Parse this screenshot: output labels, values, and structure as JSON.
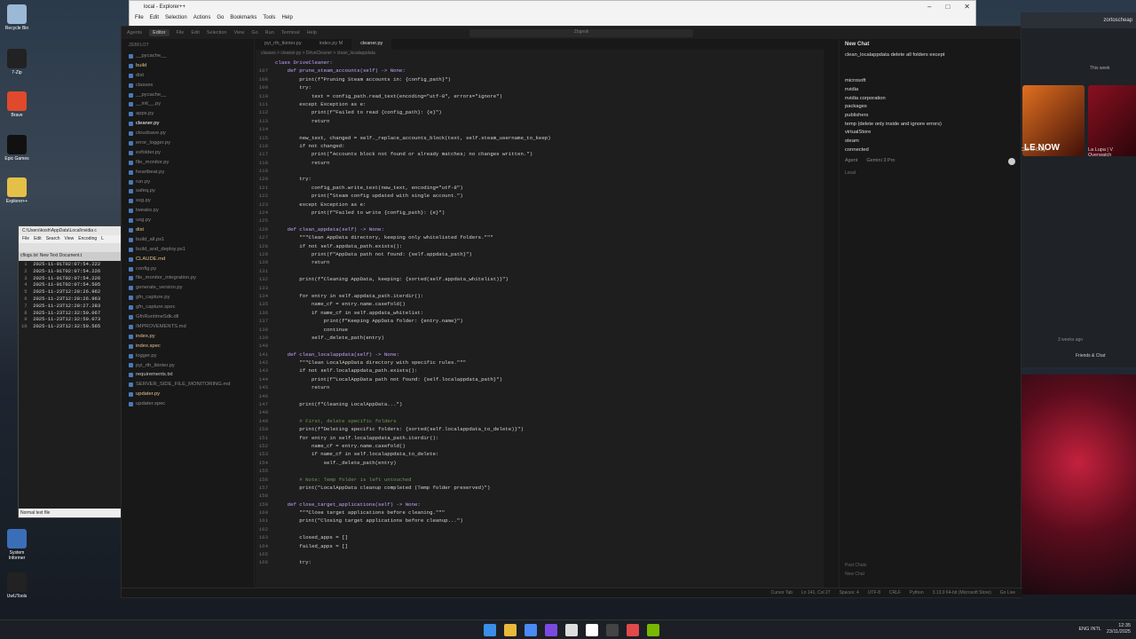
{
  "desktop": {
    "icons": [
      {
        "label": "Recycle Bin",
        "color": "#9bb8d6"
      },
      {
        "label": "7-Zip",
        "color": "#222"
      },
      {
        "label": "Brave",
        "color": "#e0492b"
      },
      {
        "label": "Epic Games",
        "color": "#111"
      },
      {
        "label": "Explorer++",
        "color": "#e5c048"
      },
      {
        "label": "System Informer",
        "color": "#3a6fb8"
      },
      {
        "label": "UwUTools",
        "color": "#222"
      }
    ]
  },
  "explorer": {
    "title": "local - Explorer++",
    "menu": [
      "File",
      "Edit",
      "Selection",
      "Actions",
      "Go",
      "Bookmarks",
      "Tools",
      "Help"
    ]
  },
  "notepad": {
    "title": "C:\\Users\\kosh\\AppData\\Local\\nvidia c",
    "menu": [
      "File",
      "Edit",
      "Search",
      "View",
      "Encoding",
      "L"
    ],
    "tabs": [
      "cflogs.txt",
      "New Text Document.t"
    ],
    "lines": [
      "2025-11-01T02:07:54.222",
      "2025-11-01T02:07:54.226",
      "2025-11-01T02:07:54.226",
      "2025-11-01T02:07:54.505",
      "2025-11-23T12:28:26.962",
      "2025-11-23T12:28:26.963",
      "2025-11-23T12:28:27.283",
      "2025-11-23T12:32:50.067",
      "2025-11-23T12:32:50.073",
      "2025-11-23T12:32:50.565"
    ],
    "status": "Normal text file"
  },
  "cursor": {
    "topbar": {
      "agents": "Agents",
      "editor": "Editor",
      "menus": [
        "File",
        "Edit",
        "Selection",
        "View",
        "Go",
        "Run",
        "Terminal",
        "Help"
      ],
      "search": "Zbgesk"
    },
    "explorer_title": "ZEBFLOT",
    "files": [
      {
        "name": "__pycache__",
        "color": "#888"
      },
      {
        "name": "build",
        "color": "#e2c08d"
      },
      {
        "name": "dist",
        "color": "#888"
      },
      {
        "name": "classes",
        "color": "#888"
      },
      {
        "name": "__pycache__",
        "color": "#888"
      },
      {
        "name": "__init__.py",
        "color": "#888"
      },
      {
        "name": "apps.py",
        "color": "#888"
      },
      {
        "name": "cleaner.py",
        "color": "#fff"
      },
      {
        "name": "cloudsave.py",
        "color": "#888"
      },
      {
        "name": "error_logger.py",
        "color": "#888"
      },
      {
        "name": "exfolder.py",
        "color": "#888"
      },
      {
        "name": "file_monitor.py",
        "color": "#888"
      },
      {
        "name": "heartbeat.py",
        "color": "#888"
      },
      {
        "name": "run.py",
        "color": "#888"
      },
      {
        "name": "safeq.py",
        "color": "#888"
      },
      {
        "name": "ssg.py",
        "color": "#888"
      },
      {
        "name": "tweaks.py",
        "color": "#888"
      },
      {
        "name": "usg.py",
        "color": "#888"
      },
      {
        "name": "dist",
        "color": "#e2c08d"
      },
      {
        "name": "build_all.ps1",
        "color": "#888"
      },
      {
        "name": "build_and_deploy.ps1",
        "color": "#888"
      },
      {
        "name": "CLAUDE.md",
        "color": "#e2c08d"
      },
      {
        "name": "config.py",
        "color": "#888"
      },
      {
        "name": "file_monitor_integration.py",
        "color": "#888"
      },
      {
        "name": "generate_version.py",
        "color": "#888"
      },
      {
        "name": "gfn_capture.py",
        "color": "#888"
      },
      {
        "name": "gfn_capture.spec",
        "color": "#888"
      },
      {
        "name": "GfnRuntimeSdk.dll",
        "color": "#888"
      },
      {
        "name": "IMPROVEMENTS.md",
        "color": "#888"
      },
      {
        "name": "index.py",
        "color": "#e2c08d"
      },
      {
        "name": "index.spec",
        "color": "#e2c08d"
      },
      {
        "name": "logger.py",
        "color": "#888"
      },
      {
        "name": "pyi_rth_tkinter.py",
        "color": "#888"
      },
      {
        "name": "requirements.txt",
        "color": "#ccc"
      },
      {
        "name": "SERVER_SIDE_FILE_MONITORING.md",
        "color": "#888"
      },
      {
        "name": "updater.py",
        "color": "#e2c08d"
      },
      {
        "name": "updater.spec",
        "color": "#888"
      }
    ],
    "tabs": [
      "pyi_rth_tkinter.py",
      "index.py M",
      "cleaner.py"
    ],
    "breadcrumb": "classes > cleaner.py > DriveCleaner > clean_localappdata",
    "code": [
      {
        "n": "",
        "t": "class DriveCleaner:"
      },
      {
        "n": "107",
        "t": "    def prune_steam_accounts(self) -> None:"
      },
      {
        "n": "108",
        "t": "        print(f\"Pruning Steam accounts in: {config_path}\")"
      },
      {
        "n": "109",
        "t": "        try:"
      },
      {
        "n": "110",
        "t": "            text = config_path.read_text(encoding=\"utf-8\", errors=\"ignore\")"
      },
      {
        "n": "111",
        "t": "        except Exception as e:"
      },
      {
        "n": "112",
        "t": "            print(f\"Failed to read {config_path}: {e}\")"
      },
      {
        "n": "113",
        "t": "            return"
      },
      {
        "n": "114",
        "t": ""
      },
      {
        "n": "115",
        "t": "        new_text, changed = self._replace_accounts_block(text, self.steam_username_to_keep)"
      },
      {
        "n": "116",
        "t": "        if not changed:"
      },
      {
        "n": "117",
        "t": "            print(\"Accounts block not found or already matches; no changes written.\")"
      },
      {
        "n": "118",
        "t": "            return"
      },
      {
        "n": "119",
        "t": ""
      },
      {
        "n": "120",
        "t": "        try:"
      },
      {
        "n": "121",
        "t": "            config_path.write_text(new_text, encoding=\"utf-8\")"
      },
      {
        "n": "122",
        "t": "            print(\"Steam config updated with single account.\")"
      },
      {
        "n": "123",
        "t": "        except Exception as e:"
      },
      {
        "n": "124",
        "t": "            print(f\"Failed to write {config_path}: {e}\")"
      },
      {
        "n": "125",
        "t": ""
      },
      {
        "n": "126",
        "t": "    def clean_appdata(self) -> None:"
      },
      {
        "n": "127",
        "t": "        \"\"\"Clean AppData directory, keeping only whitelisted folders.\"\"\""
      },
      {
        "n": "128",
        "t": "        if not self.appdata_path.exists():"
      },
      {
        "n": "129",
        "t": "            print(f\"AppData path not found: {self.appdata_path}\")"
      },
      {
        "n": "130",
        "t": "            return"
      },
      {
        "n": "131",
        "t": ""
      },
      {
        "n": "132",
        "t": "        print(f\"Cleaning AppData, keeping: {sorted(self.appdata_whitelist)}\")"
      },
      {
        "n": "133",
        "t": ""
      },
      {
        "n": "134",
        "t": "        for entry in self.appdata_path.iterdir():"
      },
      {
        "n": "135",
        "t": "            name_cf = entry.name.casefold()"
      },
      {
        "n": "136",
        "t": "            if name_cf in self.appdata_whitelist:"
      },
      {
        "n": "137",
        "t": "                print(f\"Keeping AppData folder: {entry.name}\")"
      },
      {
        "n": "138",
        "t": "                continue"
      },
      {
        "n": "139",
        "t": "            self._delete_path(entry)"
      },
      {
        "n": "140",
        "t": ""
      },
      {
        "n": "141",
        "t": "    def clean_localappdata(self) -> None:"
      },
      {
        "n": "142",
        "t": "        \"\"\"Clean LocalAppData directory with specific rules.\"\"\""
      },
      {
        "n": "143",
        "t": "        if not self.localappdata_path.exists():"
      },
      {
        "n": "144",
        "t": "            print(f\"LocalAppData path not found: {self.localappdata_path}\")"
      },
      {
        "n": "145",
        "t": "            return"
      },
      {
        "n": "146",
        "t": ""
      },
      {
        "n": "147",
        "t": "        print(f\"Cleaning LocalAppData...\")"
      },
      {
        "n": "148",
        "t": ""
      },
      {
        "n": "149",
        "t": "        # First, delete specific folders"
      },
      {
        "n": "150",
        "t": "        print(f\"Deleting specific folders: {sorted(self.localappdata_to_delete)}\")"
      },
      {
        "n": "151",
        "t": "        for entry in self.localappdata_path.iterdir():"
      },
      {
        "n": "152",
        "t": "            name_cf = entry.name.casefold()"
      },
      {
        "n": "153",
        "t": "            if name_cf in self.localappdata_to_delete:"
      },
      {
        "n": "154",
        "t": "                self._delete_path(entry)"
      },
      {
        "n": "155",
        "t": ""
      },
      {
        "n": "156",
        "t": "        # Note: Temp folder is left untouched"
      },
      {
        "n": "157",
        "t": "        print(\"LocalAppData cleanup completed (Temp folder preserved)\")"
      },
      {
        "n": "158",
        "t": ""
      },
      {
        "n": "159",
        "t": "    def close_target_applications(self) -> None:"
      },
      {
        "n": "160",
        "t": "        \"\"\"Close target applications before cleaning.\"\"\""
      },
      {
        "n": "161",
        "t": "        print(\"Closing target applications before cleanup...\")"
      },
      {
        "n": "162",
        "t": ""
      },
      {
        "n": "163",
        "t": "        closed_apps = []"
      },
      {
        "n": "164",
        "t": "        failed_apps = []"
      },
      {
        "n": "165",
        "t": ""
      },
      {
        "n": "166",
        "t": "        try:"
      }
    ],
    "chat": {
      "title": "New Chat",
      "message": [
        "clean_localappdata delete all folders except",
        "",
        "",
        "microsoft",
        "nvidia",
        "nvidia corporation",
        "packages",
        "publishers",
        "temp (delete only inside and ignore errors)",
        "virtualStore",
        "steam",
        "connected"
      ],
      "mode": "Agent",
      "model": "Gemini 3 Pro",
      "local": "Local",
      "footer1": "Past Chats",
      "footer2": "New Chat"
    },
    "status": [
      "Cursor Tab",
      "Ln 141, Col 27",
      "Spaces: 4",
      "UTF-8",
      "CRLF",
      "Python",
      "3.13.9 64-bit (Microsoft Store)",
      "Go Live"
    ]
  },
  "bgapp": {
    "user": "zortoscheap",
    "week": "This week",
    "news": "LE NOW",
    "card1": "Call of Duty:",
    "card2": "La Lupa | V Overwatch",
    "ago": "3 weeks ago",
    "friends": "Friends & Chat"
  },
  "taskbar": {
    "lang": "ENG INTL",
    "time": "12:35",
    "date": "23/11/2025",
    "icons": [
      {
        "name": "start",
        "color": "#3b8ee8"
      },
      {
        "name": "folder",
        "color": "#e8b93b"
      },
      {
        "name": "chrome",
        "color": "#4a8af4"
      },
      {
        "name": "app",
        "color": "#7a4ae0"
      },
      {
        "name": "terminal",
        "color": "#ddd"
      },
      {
        "name": "notion",
        "color": "#fff"
      },
      {
        "name": "cursor",
        "color": "#444"
      },
      {
        "name": "git",
        "color": "#e04a4a"
      },
      {
        "name": "nvidia",
        "color": "#76b900"
      }
    ]
  }
}
